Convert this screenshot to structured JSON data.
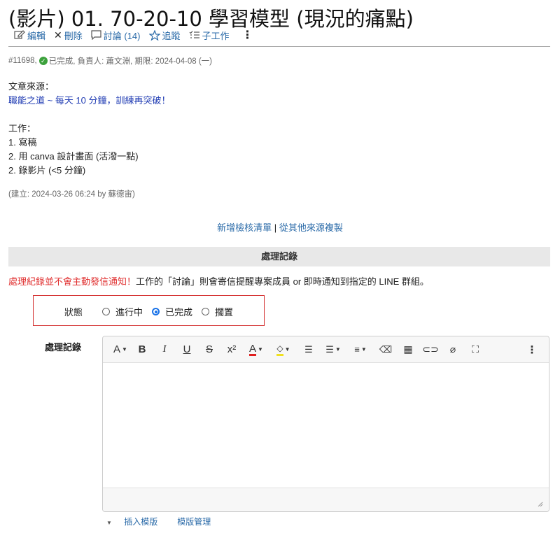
{
  "title": "(影片) 01. 70-20-10 學習模型 (現況的痛點)",
  "actions": [
    {
      "label": "編輯",
      "icon": "edit-icon"
    },
    {
      "label": "刪除",
      "icon": "close-icon"
    },
    {
      "label": "討論 (14)",
      "icon": "comment-icon"
    },
    {
      "label": "追蹤",
      "icon": "star-icon"
    },
    {
      "label": "子工作",
      "icon": "subtask-icon"
    }
  ],
  "meta": {
    "id": "#11698,",
    "status": "已完成,",
    "assignee": "負責人: 蕭文淵,",
    "deadline": "期限: 2024-04-08 (一)"
  },
  "body": {
    "source_label": "文章來源：",
    "source_link": "職能之道 ~ 每天 10 分鐘，訓練再突破！",
    "work_label": "工作：",
    "items": [
      "1. 寫稿",
      "2. 用 canva 設計畫面 (活潑一點)",
      "2. 錄影片 (<5 分鐘)"
    ]
  },
  "created": "(建立: 2024-03-26 06:24 by 蘇德宙)",
  "links": {
    "checklist": "新增檢核清單",
    "sep": "|",
    "copy": "從其他來源複製"
  },
  "section_title": "處理記錄",
  "notice": {
    "red": "處理紀錄並不會主動發信通知！",
    "rest": "工作的「討論」則會寄信提醒專案成員 or 即時通知到指定的 LINE 群組。"
  },
  "status": {
    "label": "狀態",
    "options": [
      "進行中",
      "已完成",
      "擱置"
    ],
    "selected": "已完成"
  },
  "editor": {
    "label": "處理記錄"
  },
  "templates": {
    "insert": "插入模版",
    "manage": "模版管理"
  },
  "colors": {
    "link": "#2a6aa8",
    "accent": "#1a73e8",
    "alert": "#e03030",
    "done": "#3ca13c"
  }
}
